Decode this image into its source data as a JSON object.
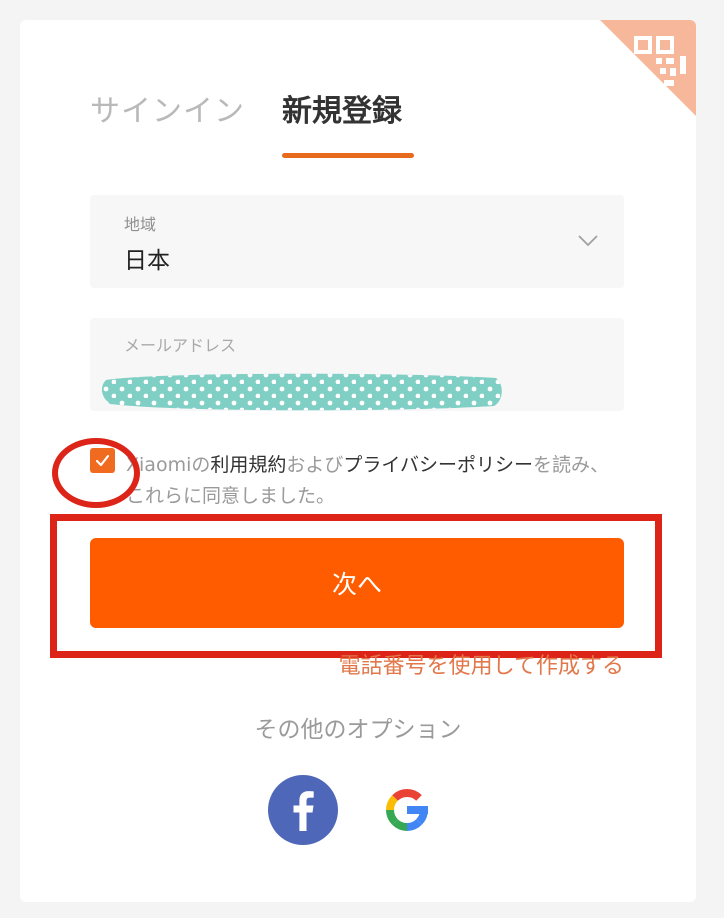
{
  "tabs": {
    "signin_label": "サインイン",
    "register_label": "新規登録"
  },
  "region": {
    "label": "地域",
    "value": "日本"
  },
  "email": {
    "label": "メールアドレス"
  },
  "consent": {
    "checked": true,
    "brand": "Xiaomi",
    "prefix": "の",
    "terms_link": "利用規約",
    "and": "および",
    "privacy_link": "プライバシーポリシー",
    "suffix": "を読み、これらに同意しました。"
  },
  "next_button_label": "次へ",
  "phone_link": "電話番号を使用して作成する",
  "other_options_label": "その他のオプション",
  "social": {
    "facebook_icon": "facebook-icon",
    "google_icon": "google-icon"
  },
  "colors": {
    "accent": "#ff5c00",
    "annotation": "#dd2418",
    "tab_underline": "#e86a1c"
  }
}
